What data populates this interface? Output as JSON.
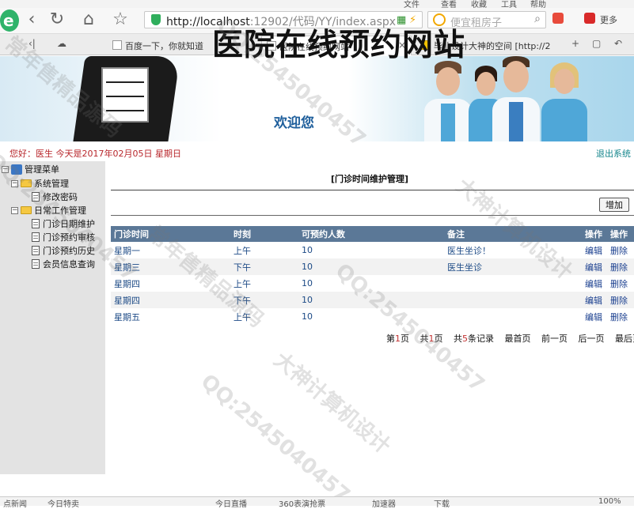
{
  "browser": {
    "menu": [
      "文件",
      "查看",
      "收藏",
      "工具",
      "帮助"
    ],
    "url_host": "http://localhost",
    "url_rest": ":12902/代码/YY/index.aspx",
    "search_placeholder": "便宜租房子",
    "more_label": "更多",
    "tabs": [
      {
        "label": "百度一下，你就知道"
      },
      {
        "label": "医院在线预约网站"
      },
      {
        "label": "毕业设计大神的空间 [http://2"
      }
    ]
  },
  "header": {
    "title": "医院在线预约网站",
    "subtitle": "欢迎您"
  },
  "infobar": {
    "greeting": "您好：医生   今天是2017年02月05日   星期日",
    "logout": "退出系统"
  },
  "sidebar": {
    "root": "管理菜单",
    "groups": [
      {
        "label": "系统管理",
        "items": [
          "修改密码"
        ]
      },
      {
        "label": "日常工作管理",
        "items": [
          "门诊日期维护",
          "门诊预约审核",
          "门诊预约历史",
          "会员信息查询"
        ]
      }
    ]
  },
  "main": {
    "title": "[门诊时间维护管理]",
    "add_label": "增加",
    "columns": [
      "门诊时间",
      "时刻",
      "可预约人数",
      "备注",
      "操作",
      "操作"
    ],
    "rows": [
      {
        "day": "星期一",
        "time": "上午",
        "count": "10",
        "note": "医生坐诊！",
        "edit": "编辑",
        "del": "删除"
      },
      {
        "day": "星期三",
        "time": "下午",
        "count": "10",
        "note": "医生坐诊",
        "edit": "编辑",
        "del": "删除"
      },
      {
        "day": "星期四",
        "time": "上午",
        "count": "10",
        "note": "",
        "edit": "编辑",
        "del": "删除"
      },
      {
        "day": "星期四",
        "time": "下午",
        "count": "10",
        "note": "",
        "edit": "编辑",
        "del": "删除"
      },
      {
        "day": "星期五",
        "time": "上午",
        "count": "10",
        "note": "",
        "edit": "编辑",
        "del": "删除"
      }
    ],
    "pager": {
      "page_prefix": "第",
      "page_num": "1",
      "page_suffix": "页",
      "total_prefix": "共",
      "total_num": "1",
      "total_suffix": "页",
      "rec_prefix": "共",
      "rec_num": "5",
      "rec_suffix": "条记录",
      "first": "最首页",
      "prev": "前一页",
      "next": "后一页",
      "last": "最后页"
    }
  },
  "watermarks": [
    "QQ:2545040457",
    "大神计算机设计",
    "常年售精品源码"
  ],
  "statusbar": [
    "点新闻",
    "今日特卖",
    "今日直播",
    "360表演抢票",
    "加速器",
    "下载",
    "100%"
  ]
}
